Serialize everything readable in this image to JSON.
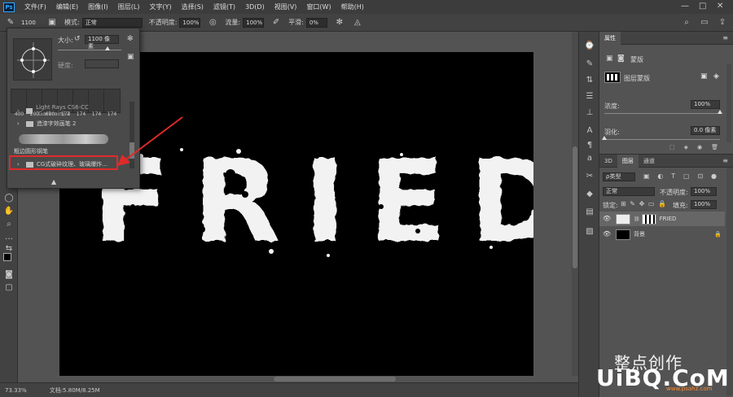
{
  "app": {
    "logo": "Ps",
    "menu": [
      "文件(F)",
      "编辑(E)",
      "图像(I)",
      "图层(L)",
      "文字(Y)",
      "选择(S)",
      "滤镜(T)",
      "3D(D)",
      "视图(V)",
      "窗口(W)",
      "帮助(H)"
    ],
    "win_controls": [
      "—",
      "□",
      "✕"
    ]
  },
  "options": {
    "brush_size": "1100",
    "mode_label": "模式:",
    "mode_value": "正常",
    "opacity_label": "不透明度:",
    "opacity_value": "100%",
    "flow_label": "流量:",
    "flow_value": "100%",
    "smooth_label": "平滑:",
    "smooth_value": "0%"
  },
  "brush_panel": {
    "size_label": "大小:",
    "size_value": "1100 像素",
    "hardness_label": "硬度:",
    "tip_sizes": [
      "400",
      "200",
      "600",
      "174",
      "174",
      "174",
      "174"
    ],
    "list": [
      {
        "label": "Light Rays CS6-CC (Garkrain) 2"
      },
      {
        "label": "造漆字效画笔 2"
      },
      {
        "label": "粗边圆形钢笔"
      },
      {
        "label": "CG式破碎纹理、玻璃爆炸..."
      }
    ]
  },
  "canvas_text": "FRIED",
  "status": {
    "zoom": "73.33%",
    "doc": "文档:5.80M/8.25M"
  },
  "properties": {
    "tab": "属性",
    "mask_title": "蒙版",
    "layer_mask": "图层蒙版",
    "density_label": "浓度:",
    "density_value": "100%",
    "density_level": 1.0,
    "feather_label": "羽化:",
    "feather_value": "0.0 像素",
    "feather_level": 0.0
  },
  "layers_panel": {
    "tabs": [
      "3D",
      "图层",
      "通道"
    ],
    "filter": "ρ类型",
    "blend_mode": "正常",
    "opacity_label": "不透明度:",
    "opacity_value": "100%",
    "lock_label": "锁定:",
    "fill_label": "填充:",
    "fill_value": "100%",
    "layers": [
      {
        "name": "FRIED"
      },
      {
        "name": "背景"
      }
    ]
  },
  "watermark": {
    "line1": "整点创作",
    "line2": "UiBQ.CoM",
    "line3": "www.psahz.com"
  },
  "colors": {
    "accent_red": "#e02a2a",
    "ps_blue": "#31a8ff"
  }
}
